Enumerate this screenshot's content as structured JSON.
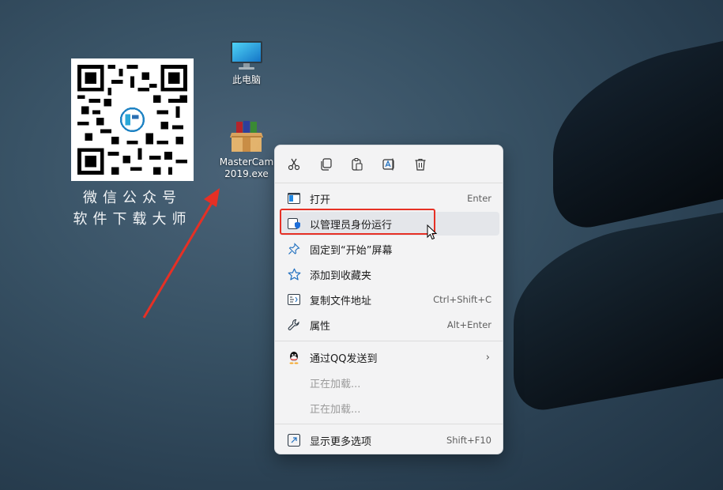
{
  "desktop": {
    "icons": [
      {
        "label": "此电脑",
        "icon": "monitor-icon"
      },
      {
        "label": "MasterCam\n2019.exe",
        "icon": "winrar-archive-icon"
      }
    ],
    "qr_card": {
      "caption_line1": "微信公众号",
      "caption_line2": "软件下载大师"
    }
  },
  "context_menu": {
    "toolbar": [
      {
        "icon": "cut-icon"
      },
      {
        "icon": "copy-icon"
      },
      {
        "icon": "paste-icon"
      },
      {
        "icon": "rename-icon"
      },
      {
        "icon": "delete-icon"
      }
    ],
    "items": [
      {
        "label": "打开",
        "shortcut": "Enter",
        "icon": "open-icon"
      },
      {
        "label": "以管理员身份运行",
        "shortcut": "",
        "icon": "admin-shield-icon"
      },
      {
        "label": "固定到“开始”屏幕",
        "shortcut": "",
        "icon": "pin-icon"
      },
      {
        "label": "添加到收藏夹",
        "shortcut": "",
        "icon": "star-icon"
      },
      {
        "label": "复制文件地址",
        "shortcut": "Ctrl+Shift+C",
        "icon": "copy-path-icon"
      },
      {
        "label": "属性",
        "shortcut": "Alt+Enter",
        "icon": "wrench-icon"
      },
      {
        "label": "通过QQ发送到",
        "shortcut": "",
        "icon": "qq-icon"
      },
      {
        "label": "正在加载...",
        "shortcut": "",
        "icon": ""
      },
      {
        "label": "正在加载...",
        "shortcut": "",
        "icon": ""
      },
      {
        "label": "显示更多选项",
        "shortcut": "Shift+F10",
        "icon": "more-options-icon"
      }
    ]
  },
  "colors": {
    "highlight": "#e63025",
    "arrow": "#e63025"
  }
}
